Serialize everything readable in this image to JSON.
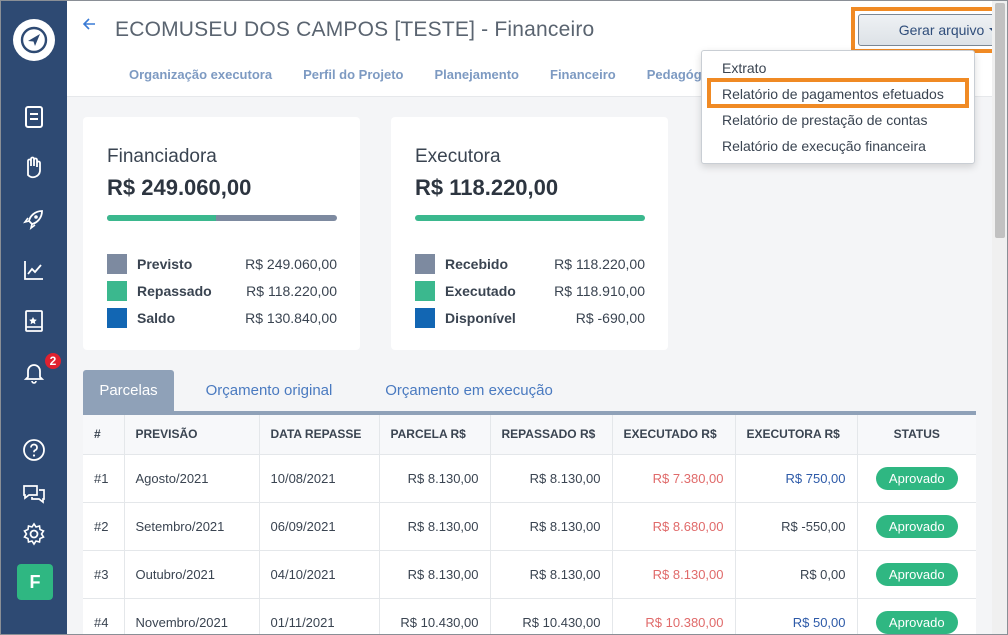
{
  "header": {
    "title": "ECOMUSEU DOS CAMPOS [TESTE] - Financeiro",
    "generate_button": "Gerar arquivo",
    "nav_tabs": [
      "Organização executora",
      "Perfil do Projeto",
      "Planejamento",
      "Financeiro",
      "Pedagóg"
    ]
  },
  "dropdown": {
    "items": [
      "Extrato",
      "Relatório de pagamentos efetuados",
      "Relatório de prestação de contas",
      "Relatório de execução financeira"
    ]
  },
  "sidebar": {
    "notification_count": "2",
    "avatar_letter": "F"
  },
  "cards": {
    "financiadora": {
      "title": "Financiadora",
      "amount": "R$ 249.060,00",
      "progress_fraction": 0.474,
      "legend": [
        {
          "label": "Previsto",
          "value": "R$ 249.060,00",
          "color": "#7d8aa0"
        },
        {
          "label": "Repassado",
          "value": "R$ 118.220,00",
          "color": "#3bb88e"
        },
        {
          "label": "Saldo",
          "value": "R$ 130.840,00",
          "color": "#1266b3"
        }
      ]
    },
    "executora": {
      "title": "Executora",
      "amount": "R$ 118.220,00",
      "progress_fraction": 1.0,
      "legend": [
        {
          "label": "Recebido",
          "value": "R$ 118.220,00",
          "color": "#7d8aa0"
        },
        {
          "label": "Executado",
          "value": "R$ 118.910,00",
          "color": "#3bb88e"
        },
        {
          "label": "Disponível",
          "value": "R$ -690,00",
          "color": "#1266b3"
        }
      ]
    }
  },
  "panel_tabs": [
    "Parcelas",
    "Orçamento original",
    "Orçamento em execução"
  ],
  "table": {
    "headers": [
      "#",
      "PREVISÃO",
      "DATA REPASSE",
      "PARCELA R$",
      "REPASSADO R$",
      "EXECUTADO R$",
      "EXECUTORA R$",
      "STATUS"
    ],
    "rows": [
      [
        "#1",
        "Agosto/2021",
        "10/08/2021",
        "R$ 8.130,00",
        "R$ 8.130,00",
        "R$ 7.380,00",
        "R$ 750,00",
        "Aprovado"
      ],
      [
        "#2",
        "Setembro/2021",
        "06/09/2021",
        "R$ 8.130,00",
        "R$ 8.130,00",
        "R$ 8.680,00",
        "R$ -550,00",
        "Aprovado"
      ],
      [
        "#3",
        "Outubro/2021",
        "04/10/2021",
        "R$ 8.130,00",
        "R$ 8.130,00",
        "R$ 8.130,00",
        "R$ 0,00",
        "Aprovado"
      ],
      [
        "#4",
        "Novembro/2021",
        "01/11/2021",
        "R$ 10.430,00",
        "R$ 10.430,00",
        "R$ 10.380,00",
        "R$ 50,00",
        "Aprovado"
      ]
    ],
    "executora_colors": [
      "blue",
      "dark",
      "dark",
      "blue"
    ]
  }
}
